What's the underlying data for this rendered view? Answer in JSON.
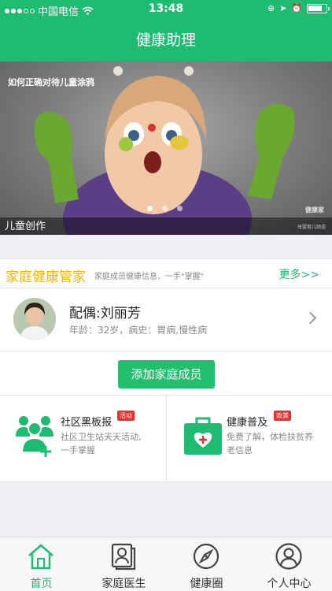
{
  "status_bar": {
    "carrier": "中国电信",
    "time": "13:48"
  },
  "nav": {
    "title": "健康助理"
  },
  "banner": {
    "overlay_title": "如何正确对待儿童涂鸦",
    "caption": "儿童创作",
    "watermark": "健康家",
    "watermark_sub": "母婴育儿频道",
    "slide_count": 3,
    "active_slide": 1
  },
  "family_section": {
    "title": "家庭健康管家",
    "subtitle": "家庭成员健康信息，一手\"掌握\"",
    "more": "更多>>"
  },
  "member": {
    "name": "配偶:刘丽芳",
    "info": "年龄：32岁，病史：胃病,慢性病"
  },
  "add_member_button": "添加家庭成员",
  "cards": [
    {
      "title": "社区黑板报",
      "tag": "活动",
      "desc_line1": "社区卫生站天天活动,",
      "desc_line2": "一手掌握",
      "icon": "community-group-icon"
    },
    {
      "title": "健康普及",
      "tag": "政策",
      "desc_line1": "免费了解，体检扶贫养",
      "desc_line2": "老信息",
      "icon": "medical-kit-icon"
    }
  ],
  "tabs": [
    {
      "label": "首页",
      "icon": "home-icon",
      "active": true
    },
    {
      "label": "家庭医生",
      "icon": "doctor-card-icon",
      "active": false
    },
    {
      "label": "健康圈",
      "icon": "compass-icon",
      "active": false
    },
    {
      "label": "个人中心",
      "icon": "user-icon",
      "active": false
    }
  ],
  "colors": {
    "brand": "#1ebc70",
    "accent": "#f6b500",
    "tag": "#e8302d"
  }
}
